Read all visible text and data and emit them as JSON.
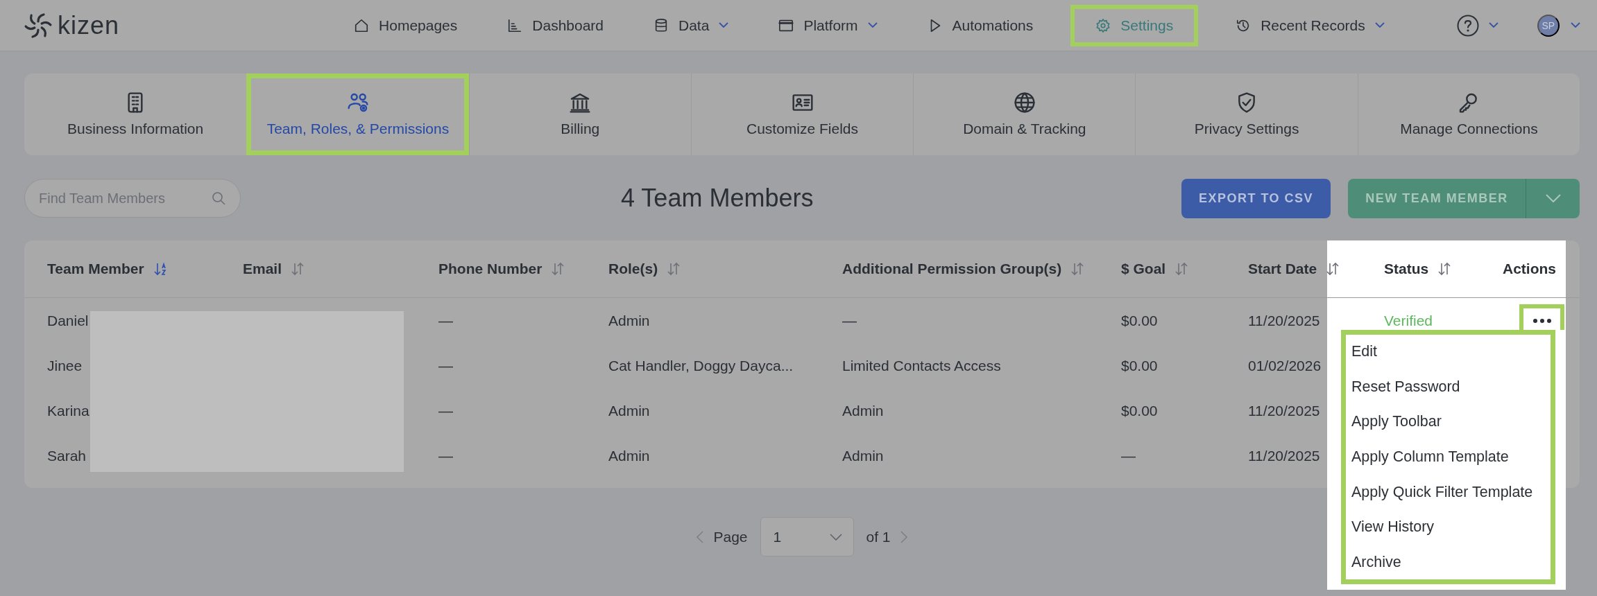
{
  "logo": {
    "text": "kizen"
  },
  "nav": [
    {
      "label": "Homepages",
      "has_menu": false,
      "selected": false,
      "highlighted": false
    },
    {
      "label": "Dashboard",
      "has_menu": false,
      "selected": false,
      "highlighted": false
    },
    {
      "label": "Data",
      "has_menu": true,
      "selected": false,
      "highlighted": false
    },
    {
      "label": "Platform",
      "has_menu": true,
      "selected": false,
      "highlighted": false
    },
    {
      "label": "Automations",
      "has_menu": false,
      "selected": false,
      "highlighted": false
    },
    {
      "label": "Settings",
      "has_menu": false,
      "selected": true,
      "highlighted": true
    },
    {
      "label": "Recent Records",
      "has_menu": true,
      "selected": false,
      "highlighted": false
    }
  ],
  "help": {
    "has_menu": true
  },
  "user": {
    "initials": "SP",
    "has_menu": true
  },
  "settings_tabs": [
    {
      "label": "Business Information",
      "selected": false,
      "highlighted": false
    },
    {
      "label": "Team, Roles, & Permissions",
      "selected": true,
      "highlighted": true
    },
    {
      "label": "Billing",
      "selected": false,
      "highlighted": false
    },
    {
      "label": "Customize Fields",
      "selected": false,
      "highlighted": false
    },
    {
      "label": "Domain & Tracking",
      "selected": false,
      "highlighted": false
    },
    {
      "label": "Privacy Settings",
      "selected": false,
      "highlighted": false
    },
    {
      "label": "Manage Connections",
      "selected": false,
      "highlighted": false
    }
  ],
  "search": {
    "placeholder": "Find Team Members"
  },
  "title": "4 Team Members",
  "buttons": {
    "export": "EXPORT TO CSV",
    "new_member": "NEW TEAM MEMBER"
  },
  "table": {
    "email_redacted": true,
    "columns": [
      {
        "label": "Team Member",
        "sorted": true
      },
      {
        "label": "Email",
        "sorted": false
      },
      {
        "label": "Phone Number",
        "sorted": false
      },
      {
        "label": "Role(s)",
        "sorted": false
      },
      {
        "label": "Additional Permission Group(s)",
        "sorted": false
      },
      {
        "label": "$ Goal",
        "sorted": false
      },
      {
        "label": "Start Date",
        "sorted": false
      },
      {
        "label": "Status",
        "sorted": false
      },
      {
        "label": "Actions"
      }
    ],
    "rows": [
      {
        "team_member": "Daniel",
        "phone": "—",
        "roles": "Admin",
        "permission_groups": "—",
        "goal": "$0.00",
        "start_date": "11/20/2025",
        "status": "Verified",
        "actions_highlighted": true
      },
      {
        "team_member": "Jinee",
        "phone": "—",
        "roles": "Cat Handler, Doggy Dayca...",
        "permission_groups": "Limited Contacts Access",
        "goal": "$0.00",
        "start_date": "01/02/2026"
      },
      {
        "team_member": "Karina",
        "phone": "—",
        "roles": "Admin",
        "permission_groups": "Admin",
        "goal": "$0.00",
        "start_date": "11/20/2025"
      },
      {
        "team_member": "Sarah",
        "phone": "—",
        "roles": "Admin",
        "permission_groups": "Admin",
        "goal": "—",
        "start_date": "11/20/2025"
      }
    ]
  },
  "action_menu": {
    "highlighted": true,
    "items": [
      "Edit",
      "Reset Password",
      "Apply Toolbar",
      "Apply Column Template",
      "Apply Quick Filter Template",
      "View History",
      "Archive"
    ]
  },
  "pagination": {
    "label": "Page",
    "page": "1",
    "total": "of 1"
  }
}
